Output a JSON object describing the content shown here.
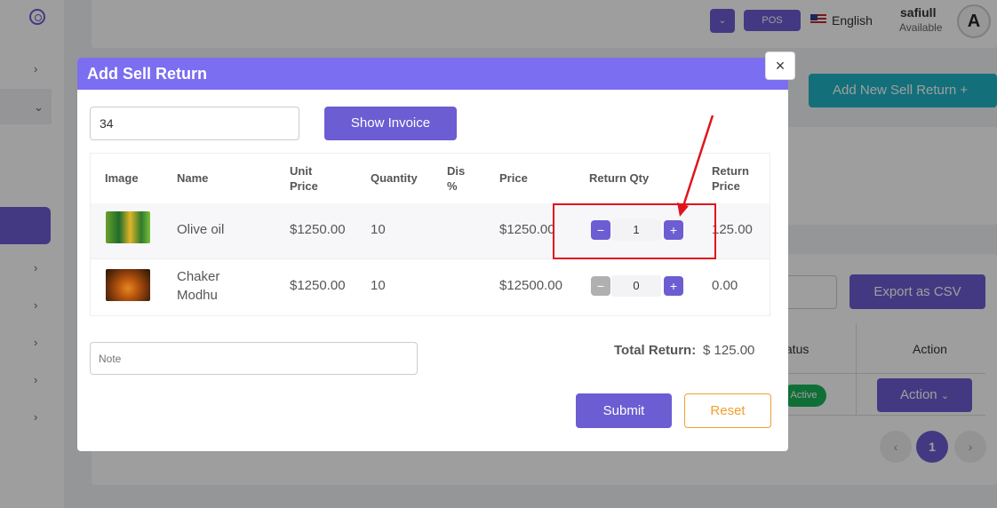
{
  "header": {
    "pos_label": "POS",
    "language": "English",
    "user_name": "safiull",
    "user_status": "Available",
    "avatar_initial": "A"
  },
  "background": {
    "add_new_label": "Add New Sell Return",
    "export_label": "Export as CSV",
    "col_status": "tatus",
    "col_action": "Action",
    "status_badge": "Active",
    "action_button": "Action",
    "pagination": {
      "prev": "‹",
      "current": "1",
      "next": "›"
    }
  },
  "modal": {
    "title": "Add Sell Return",
    "close": "×",
    "invoice_value": "34",
    "show_invoice_label": "Show Invoice",
    "columns": {
      "image": "Image",
      "name": "Name",
      "unit_price": "Unit Price",
      "quantity": "Quantity",
      "discount": "Dis %",
      "price": "Price",
      "return_qty": "Return Qty",
      "return_price": "Return Price"
    },
    "rows": [
      {
        "name": "Olive oil",
        "unit_price": "$1250.00",
        "quantity": "10",
        "discount": "",
        "price": "$1250.00",
        "return_qty": "1",
        "return_price": "125.00"
      },
      {
        "name": "Chaker Modhu",
        "unit_price": "$1250.00",
        "quantity": "10",
        "discount": "",
        "price": "$12500.00",
        "return_qty": "0",
        "return_price": "0.00"
      }
    ],
    "note_placeholder": "Note",
    "total_label": "Total Return:",
    "total_value": "$ 125.00",
    "submit_label": "Submit",
    "reset_label": "Reset"
  },
  "colors": {
    "primary": "#6c5dd3",
    "header_bar": "#7b6ef0",
    "teal": "#1fb5c5",
    "reset": "#f0a030",
    "annotation": "#e0141c"
  }
}
